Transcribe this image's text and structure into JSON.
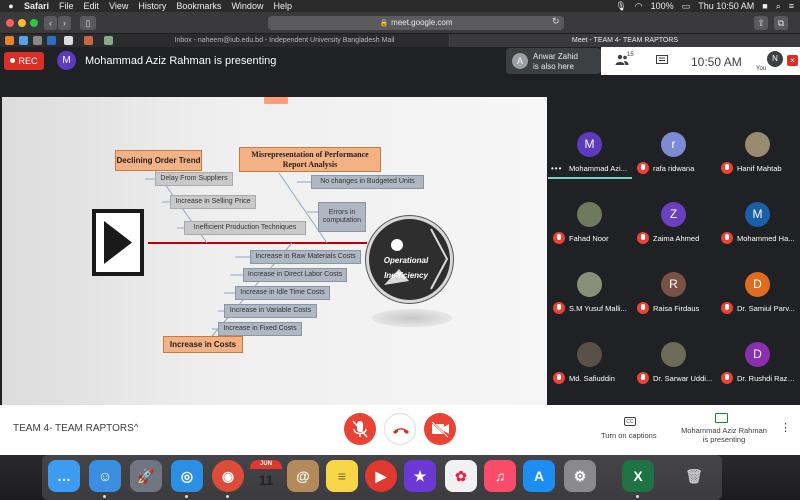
{
  "menubar": {
    "app": "Safari",
    "items": [
      "File",
      "Edit",
      "View",
      "History",
      "Bookmarks",
      "Window",
      "Help"
    ],
    "battery": "100%",
    "datetime": "Thu 10:50 AM"
  },
  "browser": {
    "url": "meet.google.com",
    "tabs": [
      {
        "label": "Inbox - naheem@iub.edu.bd - Independent University Bangladesh Mail"
      },
      {
        "label": "Meet - TEAM 4- TEAM RAPTORS"
      }
    ]
  },
  "meet": {
    "rec_label": "REC",
    "presenter_initial": "M",
    "presenting_text": "Mohammad Aziz Rahman is presenting",
    "also_here": {
      "initial": "A",
      "name": "Anwar Zahid",
      "status": "is also here"
    },
    "people_count": "15",
    "time": "10:50 AM",
    "you_initial": "N",
    "you_label": "You"
  },
  "slide": {
    "categories": {
      "order_trend": "Declining Order Trend",
      "misrep": "Misrepresentation of Performance Report Analysis",
      "costs": "Increase in Costs"
    },
    "causes_top": [
      "Delay From Suppliers",
      "Increase in Selling Price",
      "Inefficient Production Techniques"
    ],
    "causes_misrep": [
      "No changes in Budgeted Units",
      "Errors in computation"
    ],
    "causes_bottom": [
      "Increase in Raw Materials Costs",
      "Increase in Direct Labor Costs",
      "Increase in Idle Time Costs",
      "Increase in Variable Costs",
      "Increase in Fixed Costs"
    ],
    "effect": "Operational Inefficiency"
  },
  "participants": [
    {
      "initial": "M",
      "name": "Mohammad Azi...",
      "color": "#5c3bbf",
      "photo": false
    },
    {
      "initial": "r",
      "name": "rafa ridwana",
      "color": "#7c8bd4",
      "photo": false
    },
    {
      "initial": "",
      "name": "Hanif Mahtab",
      "color": "#9a8a70",
      "photo": true
    },
    {
      "initial": "",
      "name": "Fahad Noor",
      "color": "#6f7a5c",
      "photo": true
    },
    {
      "initial": "Z",
      "name": "Zaima Ahmed",
      "color": "#6a3fc0",
      "photo": false
    },
    {
      "initial": "M",
      "name": "Mohammed Ha...",
      "color": "#1a5fa8",
      "photo": false
    },
    {
      "initial": "",
      "name": "S.M Yusuf Malli...",
      "color": "#8a9078",
      "photo": true
    },
    {
      "initial": "R",
      "name": "Raisa Firdaus",
      "color": "#7a5245",
      "photo": false
    },
    {
      "initial": "D",
      "name": "Dr. Samiul Parv...",
      "color": "#e06d1f",
      "photo": false
    },
    {
      "initial": "",
      "name": "Md. Safiuddin",
      "color": "#5a5048",
      "photo": true
    },
    {
      "initial": "",
      "name": "Dr. Sarwar Uddi...",
      "color": "#6c6a58",
      "photo": true
    },
    {
      "initial": "D",
      "name": "Dr. Rushdi Razz...",
      "color": "#8a2fb0",
      "photo": false
    }
  ],
  "bottombar": {
    "meeting_name": "TEAM 4- TEAM RAPTORS",
    "captions_label": "Turn on captions",
    "captions_icon_text": "CC",
    "present_label": "Mohammad Aziz Rahman is presenting"
  },
  "dock": {
    "apps": [
      {
        "name": "Messages",
        "color": "#3d9bf0",
        "glyph": "…"
      },
      {
        "name": "Finder",
        "color": "#3a8fe0",
        "glyph": "☺"
      },
      {
        "name": "Launchpad",
        "color": "#6f7681",
        "glyph": "🚀"
      },
      {
        "name": "Safari",
        "color": "#2b8fe6",
        "glyph": "◎"
      },
      {
        "name": "Chrome",
        "color": "#dd4b39",
        "glyph": "◉"
      },
      {
        "name": "Calendar",
        "color": "#fafafa",
        "glyph": "11"
      },
      {
        "name": "Contacts",
        "color": "#b48a5a",
        "glyph": "@"
      },
      {
        "name": "Notes",
        "color": "#f7d548",
        "glyph": "≡"
      },
      {
        "name": "Video Player",
        "color": "#e0382f",
        "glyph": "▶"
      },
      {
        "name": "iMovie",
        "color": "#6b38d6",
        "glyph": "★"
      },
      {
        "name": "Photos",
        "color": "#f1f1f1",
        "glyph": "✿"
      },
      {
        "name": "Music",
        "color": "#f94c6a",
        "glyph": "♫"
      },
      {
        "name": "App Store",
        "color": "#1c8ef2",
        "glyph": "A"
      },
      {
        "name": "System Preferences",
        "color": "#8a8a8e",
        "glyph": "⚙"
      },
      {
        "name": "Excel",
        "color": "#1f7244",
        "glyph": "X"
      },
      {
        "name": "Trash",
        "color": "#9ea0a4",
        "glyph": "🗑"
      }
    ],
    "calendar_month": "JUN"
  }
}
